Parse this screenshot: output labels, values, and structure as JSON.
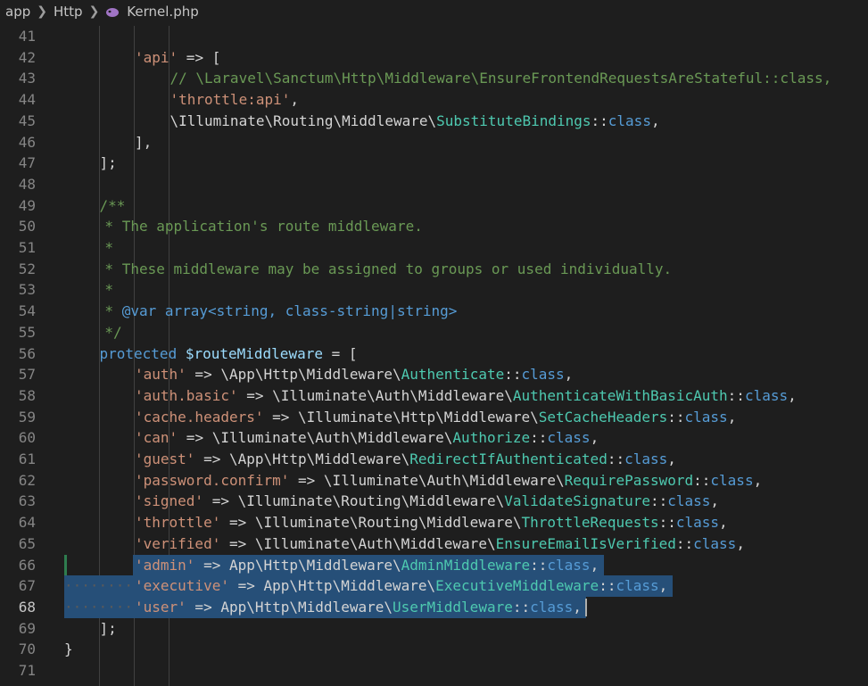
{
  "breadcrumb": {
    "items": [
      "app",
      "Http"
    ],
    "file": "Kernel.php",
    "file_icon": "php-elephant-icon",
    "separator_icon": "chevron-right-icon"
  },
  "editor": {
    "language": "php",
    "active_line": 68,
    "selection_lines": [
      66,
      67,
      68
    ],
    "lines": [
      {
        "n": "41",
        "code": ""
      },
      {
        "n": "42",
        "code": "'api' => ["
      },
      {
        "n": "43",
        "code": "// \\Laravel\\Sanctum\\Http\\Middleware\\EnsureFrontendRequestsAreStateful::class,"
      },
      {
        "n": "44",
        "code": "'throttle:api',"
      },
      {
        "n": "45",
        "code": "\\Illuminate\\Routing\\Middleware\\SubstituteBindings::class,"
      },
      {
        "n": "46",
        "code": "],"
      },
      {
        "n": "47",
        "code": "];"
      },
      {
        "n": "48",
        "code": ""
      },
      {
        "n": "49",
        "code": "/**"
      },
      {
        "n": "50",
        "code": "* The application's route middleware."
      },
      {
        "n": "51",
        "code": "*"
      },
      {
        "n": "52",
        "code": "* These middleware may be assigned to groups or used individually."
      },
      {
        "n": "53",
        "code": "*"
      },
      {
        "n": "54",
        "code": "* @var array<string, class-string|string>"
      },
      {
        "n": "55",
        "code": "*/"
      },
      {
        "n": "56",
        "code": "protected $routeMiddleware = ["
      },
      {
        "n": "57",
        "code": "'auth' => \\App\\Http\\Middleware\\Authenticate::class,"
      },
      {
        "n": "58",
        "code": "'auth.basic' => \\Illuminate\\Auth\\Middleware\\AuthenticateWithBasicAuth::class,"
      },
      {
        "n": "59",
        "code": "'cache.headers' => \\Illuminate\\Http\\Middleware\\SetCacheHeaders::class,"
      },
      {
        "n": "60",
        "code": "'can' => \\Illuminate\\Auth\\Middleware\\Authorize::class,"
      },
      {
        "n": "61",
        "code": "'guest' => \\App\\Http\\Middleware\\RedirectIfAuthenticated::class,"
      },
      {
        "n": "62",
        "code": "'password.confirm' => \\Illuminate\\Auth\\Middleware\\RequirePassword::class,"
      },
      {
        "n": "63",
        "code": "'signed' => \\Illuminate\\Routing\\Middleware\\ValidateSignature::class,"
      },
      {
        "n": "64",
        "code": "'throttle' => \\Illuminate\\Routing\\Middleware\\ThrottleRequests::class,"
      },
      {
        "n": "65",
        "code": "'verified' => \\Illuminate\\Auth\\Middleware\\EnsureEmailIsVerified::class,"
      },
      {
        "n": "66",
        "code": "'admin' => App\\Http\\Middleware\\AdminMiddleware::class,"
      },
      {
        "n": "67",
        "code": "'executive' => App\\Http\\Middleware\\ExecutiveMiddleware::class,"
      },
      {
        "n": "68",
        "code": "'user' => App\\Http\\Middleware\\UserMiddleware::class,"
      },
      {
        "n": "69",
        "code": "];"
      },
      {
        "n": "70",
        "code": "}"
      },
      {
        "n": "71",
        "code": ""
      }
    ]
  },
  "colors": {
    "background": "#1e1e1e",
    "selection": "#264f78",
    "string": "#ce9178",
    "comment": "#6a9955",
    "keyword": "#569cd6",
    "variable": "#9cdcfe",
    "class_name": "#4ec9b0",
    "modified_gutter": "#2e7d4f"
  }
}
